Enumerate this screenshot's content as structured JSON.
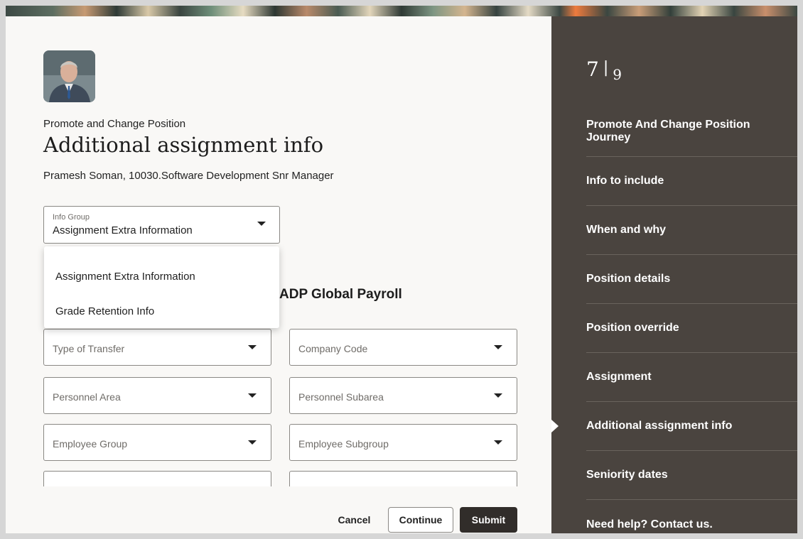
{
  "step": {
    "current": "7",
    "separator": "|",
    "total": "9"
  },
  "header": {
    "subtitle": "Promote and Change Position",
    "title": "Additional assignment info",
    "person": "Pramesh Soman, 10030.Software Development Snr Manager"
  },
  "info_group": {
    "label": "Info Group",
    "value": "Assignment Extra Information",
    "options": [
      "Assignment Extra Information",
      "Grade Retention Info"
    ]
  },
  "section_title": "ADP Global Payroll",
  "fields": [
    {
      "placeholder": "Type of Transfer"
    },
    {
      "placeholder": "Company Code"
    },
    {
      "placeholder": "Personnel Area"
    },
    {
      "placeholder": "Personnel Subarea"
    },
    {
      "placeholder": "Employee Group"
    },
    {
      "placeholder": "Employee Subgroup"
    },
    {
      "placeholder": ""
    },
    {
      "placeholder": ""
    }
  ],
  "buttons": {
    "cancel": "Cancel",
    "continue": "Continue",
    "submit": "Submit"
  },
  "sidebar": {
    "items": [
      {
        "label": "Promote And Change Position Journey"
      },
      {
        "label": "Info to include"
      },
      {
        "label": "When and why"
      },
      {
        "label": "Position details"
      },
      {
        "label": "Position override"
      },
      {
        "label": "Assignment"
      },
      {
        "label": "Additional assignment info",
        "current": true
      },
      {
        "label": "Seniority dates"
      },
      {
        "label": "Need help? Contact us."
      }
    ]
  },
  "colors": {
    "sidebar_bg": "#4a443f",
    "submit_bg": "#312d2a",
    "page_bg": "#f9f8f6"
  }
}
